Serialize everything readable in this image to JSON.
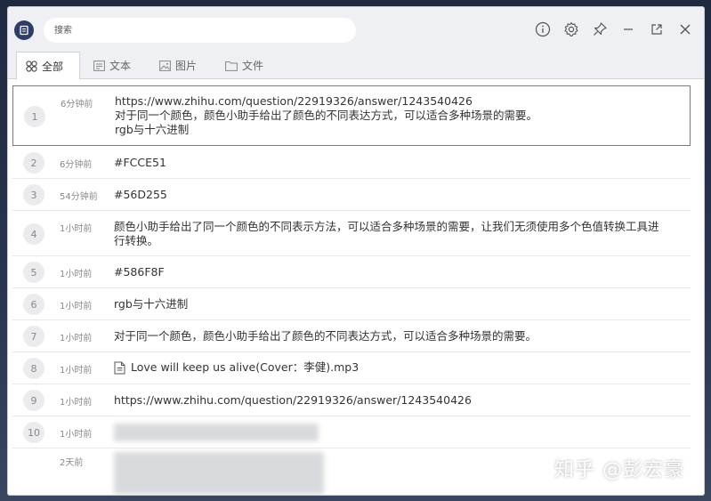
{
  "search": {
    "placeholder": "搜索"
  },
  "tabs": [
    {
      "label": "全部",
      "icon": "grid-icon",
      "active": true
    },
    {
      "label": "文本",
      "icon": "text-icon"
    },
    {
      "label": "图片",
      "icon": "image-icon"
    },
    {
      "label": "文件",
      "icon": "folder-icon"
    }
  ],
  "items": [
    {
      "num": "1",
      "time": "6分钟前",
      "lines": [
        "https://www.zhihu.com/question/22919326/answer/1243540426",
        "对于同一个颜色，颜色小助手给出了颜色的不同表达方式，可以适合多种场景的需要。",
        "rgb与十六进制"
      ]
    },
    {
      "num": "2",
      "time": "6分钟前",
      "lines": [
        "#FCCE51"
      ]
    },
    {
      "num": "3",
      "time": "54分钟前",
      "lines": [
        "#56D255"
      ]
    },
    {
      "num": "4",
      "time": "1小时前",
      "lines": [
        "颜色小助手给出了同一个颜色的不同表示方法，可以适合多种场景的需要，让我们无须使用多个色值转换工具进",
        "行转换。"
      ]
    },
    {
      "num": "5",
      "time": "1小时前",
      "lines": [
        "#586F8F"
      ]
    },
    {
      "num": "6",
      "time": "1小时前",
      "lines": [
        "rgb与十六进制"
      ]
    },
    {
      "num": "7",
      "time": "1小时前",
      "lines": [
        "对于同一个颜色，颜色小助手给出了颜色的不同表达方式，可以适合多种场景的需要。"
      ]
    },
    {
      "num": "8",
      "time": "1小时前",
      "lines": [
        "Love will keep us alive(Cover：李健).mp3"
      ]
    },
    {
      "num": "9",
      "time": "1小时前",
      "lines": [
        "https://www.zhihu.com/question/22919326/answer/1243540426"
      ]
    },
    {
      "num": "10",
      "time": "1小时前",
      "lines": []
    },
    {
      "num": "",
      "time": "2天前",
      "lines": []
    }
  ],
  "watermark": "知乎 @彭宏豪",
  "colors": {
    "accent": "#2f3d6b",
    "row_border": "#e8e9ec",
    "selected_border": "#7a7a7a"
  }
}
